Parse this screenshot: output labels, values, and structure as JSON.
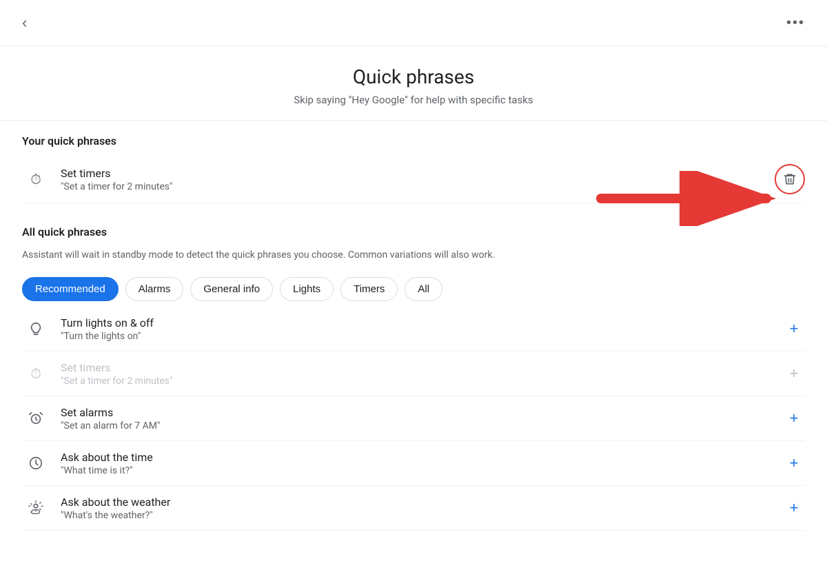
{
  "topbar": {
    "back_label": "‹",
    "more_label": "•••"
  },
  "header": {
    "title": "Quick phrases",
    "subtitle": "Skip saying \"Hey Google\" for help with specific tasks"
  },
  "your_phrases": {
    "section_title": "Your quick phrases",
    "items": [
      {
        "icon": "⏱",
        "title": "Set timers",
        "subtitle": "\"Set a timer for 2 minutes\""
      }
    ]
  },
  "all_phrases": {
    "section_title": "All quick phrases",
    "description": "Assistant will wait in standby mode to detect the quick phrases you choose. Common variations will also work.",
    "filters": [
      {
        "label": "Recommended",
        "active": true
      },
      {
        "label": "Alarms",
        "active": false
      },
      {
        "label": "General info",
        "active": false
      },
      {
        "label": "Lights",
        "active": false
      },
      {
        "label": "Timers",
        "active": false
      },
      {
        "label": "All",
        "active": false
      }
    ],
    "items": [
      {
        "icon": "💡",
        "title": "Turn lights on & off",
        "subtitle": "\"Turn the lights on\"",
        "muted": false
      },
      {
        "icon": "⏱",
        "title": "Set timers",
        "subtitle": "\"Set a timer for 2 minutes\"",
        "muted": true
      },
      {
        "icon": "⏰",
        "title": "Set alarms",
        "subtitle": "\"Set an alarm for 7 AM\"",
        "muted": false
      },
      {
        "icon": "🕐",
        "title": "Ask about the time",
        "subtitle": "\"What time is it?\"",
        "muted": false
      },
      {
        "icon": "🌤",
        "title": "Ask about the weather",
        "subtitle": "\"What's the weather?\"",
        "muted": false
      }
    ]
  },
  "colors": {
    "active_chip": "#1a73e8",
    "add_btn": "#1a73e8",
    "delete_ring": "#e53935",
    "arrow": "#e53935"
  }
}
